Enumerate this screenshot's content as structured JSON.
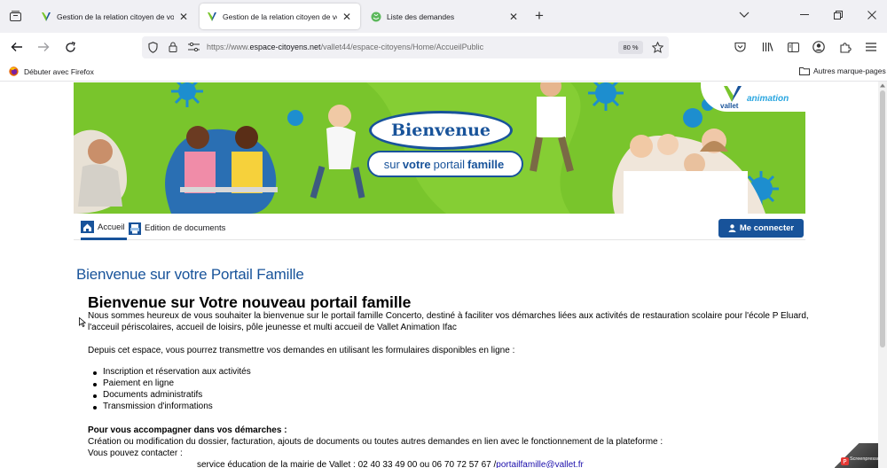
{
  "browser": {
    "tabs": [
      {
        "title": "Gestion de la relation citoyen de votre v"
      },
      {
        "title": "Gestion de la relation citoyen de votre v"
      },
      {
        "title": "Liste des demandes"
      }
    ],
    "url_prefix": "https://www.",
    "url_domain": "espace-citoyens.net",
    "url_path": "/vallet44/espace-citoyens/Home/AccueilPublic",
    "zoom": "80 %",
    "bookmark_firefox": "Débuter avec Firefox",
    "bookmark_other": "Autres marque-pages"
  },
  "banner": {
    "title": "Bienvenue",
    "subtitle_pre": "sur",
    "subtitle_bold": "votre",
    "subtitle_mid": "portail",
    "subtitle_end": "famille",
    "logo_vallet": "vallet",
    "logo_animation": "animation"
  },
  "nav": {
    "home": "Accueil",
    "docs": "Edition de documents",
    "login": "Me connecter"
  },
  "content": {
    "heading": "Bienvenue sur votre Portail Famille",
    "main_title": "Bienvenue sur Votre nouveau portail famille",
    "intro_1": "Nous sommes heureux de vous souhaiter la bienvenue sur le portail famille Concerto, destiné à faciliter vos démarches liées aux activités de restauration scolaire pour l'école P Eluard,",
    "intro_2": "l'acceuil périscolaires, accueil de loisirs, pôle jeunesse et multi accueil de Vallet Animation Ifac",
    "para_2": "Depuis cet espace, vous pourrez transmettre vos demandes en utilisant les formulaires disponibles en ligne :",
    "list": [
      "Inscription et réservation aux activités",
      "Paiement en ligne",
      "Documents administratifs",
      "Transmission d'informations"
    ],
    "accompany_title": "Pour vous accompagner dans vos démarches :",
    "accompany_text": "Création ou modification du dossier, facturation, ajouts de documents ou toutes autres demandes en lien avec le fonctionnement de la plateforme :",
    "contact_label": "Vous pouvez contacter :",
    "contact_line": "service éducation de la mairie de Vallet : 02 40 33 49 00 ou 06 70 72 57 67 /",
    "contact_email": "portailfamille@vallet.fr"
  },
  "watermark": "Screenpresso"
}
